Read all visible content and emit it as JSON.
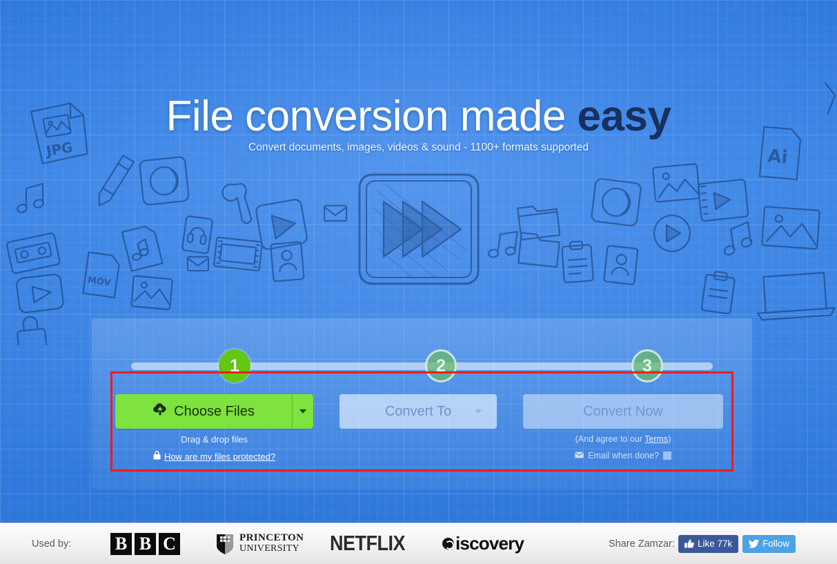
{
  "hero": {
    "headline_light": "File conversion made ",
    "headline_bold": "easy",
    "subhead": "Convert documents, images, videos & sound - 1100+ formats supported"
  },
  "steps": [
    {
      "number": "1",
      "state": "active"
    },
    {
      "number": "2",
      "state": "inactive"
    },
    {
      "number": "3",
      "state": "inactive"
    }
  ],
  "converter": {
    "choose_files_label": "Choose Files",
    "choose_files_icon": "cloud-upload-icon",
    "choose_files_caret": "chevron-down-icon",
    "convert_to_label": "Convert To",
    "convert_to_caret": "chevron-down-icon",
    "convert_now_label": "Convert Now",
    "drag_drop_text": "Drag & drop files",
    "protected_link": "How are my files protected?",
    "protected_icon": "lock-icon",
    "terms_prefix": "(And agree to our ",
    "terms_link": "Terms",
    "terms_suffix": ")",
    "email_when_done": "Email when done?",
    "email_icon": "envelope-icon",
    "email_checkbox_checked": false
  },
  "annotation": {
    "shape": "rectangle",
    "color": "#f41a1a"
  },
  "footer": {
    "used_by_label": "Used by:",
    "logos": [
      {
        "name": "bbc",
        "letters": [
          "B",
          "B",
          "C"
        ]
      },
      {
        "name": "princeton",
        "line1": "PRINCETON",
        "line2": "UNIVERSITY"
      },
      {
        "name": "netflix",
        "text": "NETFLIX"
      },
      {
        "name": "discovery",
        "text": "iscovery"
      }
    ],
    "share_label": "Share Zamzar:",
    "facebook_label": "Like 77k",
    "facebook_icon": "thumbs-up-icon",
    "twitter_label": "Follow",
    "twitter_icon": "twitter-bird-icon"
  },
  "colors": {
    "background_blue": "#3a80e2",
    "accent_green": "#7ee23f",
    "step_active_green": "#64c812",
    "annotation_red": "#f41a1a",
    "facebook_blue": "#3b5998",
    "twitter_blue": "#4ba3e3"
  }
}
